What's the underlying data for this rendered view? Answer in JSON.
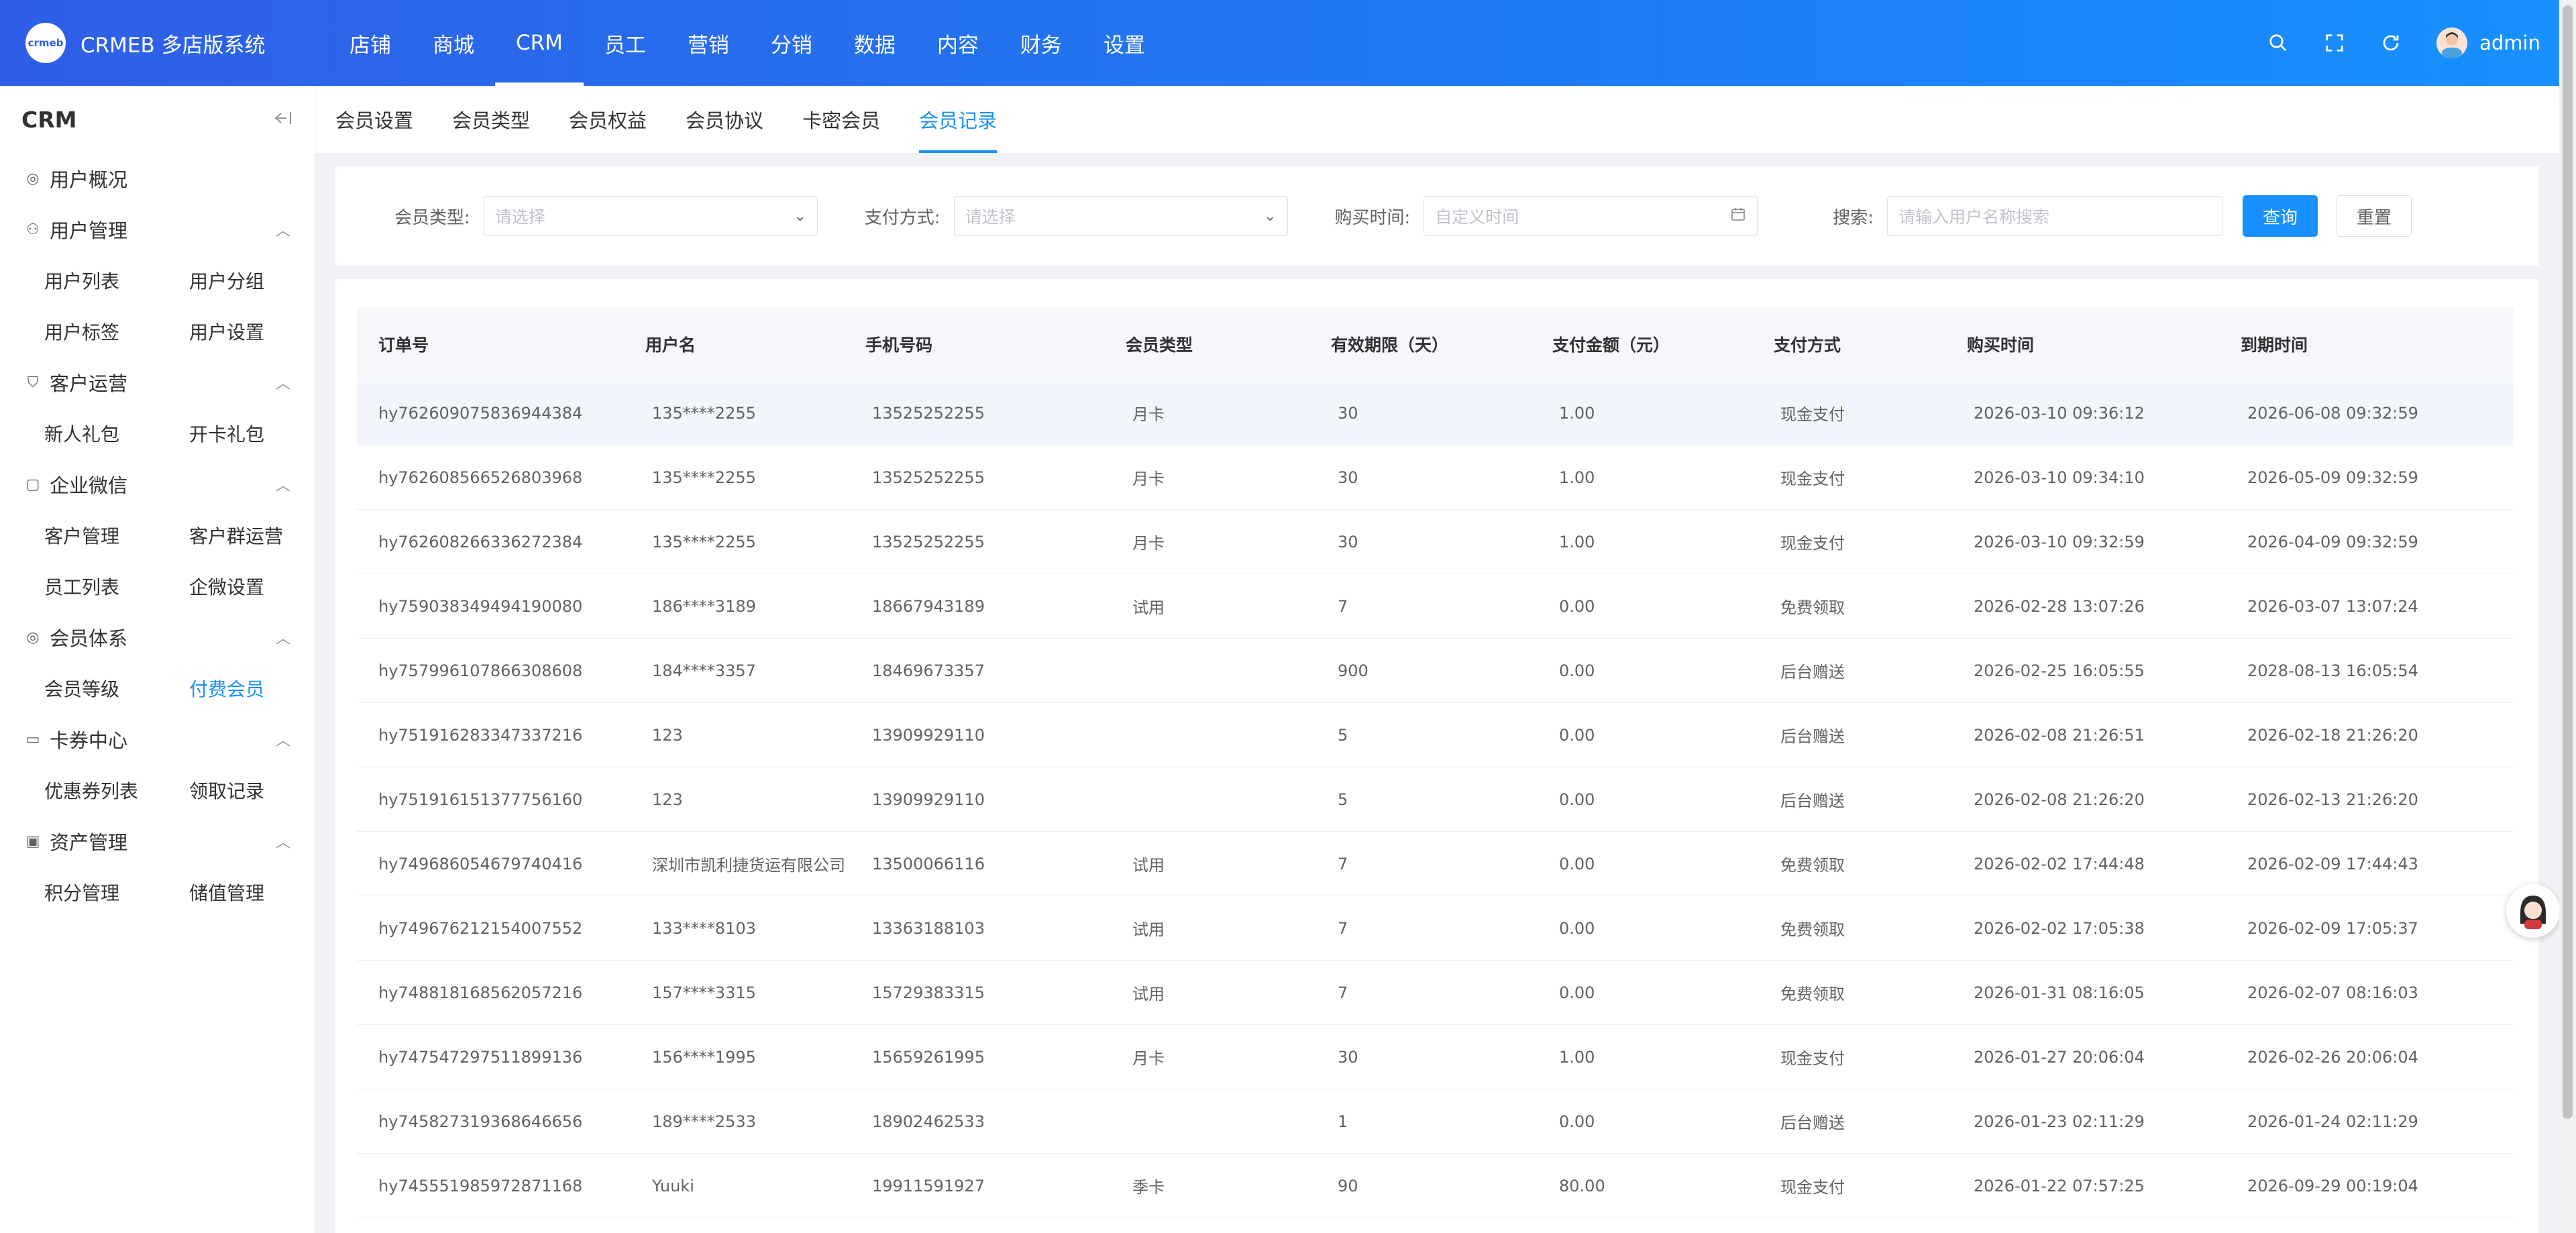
{
  "app": {
    "logo_text": "crmeb",
    "name": "CRMEB 多店版系统",
    "top_nav": [
      "店铺",
      "商城",
      "CRM",
      "员工",
      "营销",
      "分销",
      "数据",
      "内容",
      "财务",
      "设置"
    ],
    "top_nav_active": "CRM",
    "user_name": "admin",
    "accent_color": "#1890ff"
  },
  "sidebar": {
    "title": "CRM",
    "overview": "用户概况",
    "groups": [
      {
        "title": "用户管理",
        "icon": "user-icon",
        "items": [
          "用户列表",
          "用户分组",
          "用户标签",
          "用户设置"
        ]
      },
      {
        "title": "客户运营",
        "icon": "filter-icon",
        "items": [
          "新人礼包",
          "开卡礼包"
        ]
      },
      {
        "title": "企业微信",
        "icon": "chat-icon",
        "items": [
          "客户管理",
          "客户群运营",
          "员工列表",
          "企微设置"
        ]
      },
      {
        "title": "会员体系",
        "icon": "member-icon",
        "items": [
          "会员等级",
          "付费会员"
        ]
      },
      {
        "title": "卡券中心",
        "icon": "card-icon",
        "items": [
          "优惠券列表",
          "领取记录"
        ]
      },
      {
        "title": "资产管理",
        "icon": "wallet-icon",
        "items": [
          "积分管理",
          "储值管理"
        ]
      }
    ],
    "active_item": "付费会员"
  },
  "tabs": [
    "会员设置",
    "会员类型",
    "会员权益",
    "会员协议",
    "卡密会员",
    "会员记录"
  ],
  "active_tab": "会员记录",
  "filters": {
    "member_type_label": "会员类型:",
    "member_type_placeholder": "请选择",
    "pay_method_label": "支付方式:",
    "pay_method_placeholder": "请选择",
    "buy_time_label": "购买时间:",
    "buy_time_placeholder": "自定义时间",
    "search_label": "搜索:",
    "search_placeholder": "请输入用户名称搜索",
    "query_button": "查询",
    "reset_button": "重置"
  },
  "table": {
    "columns": [
      "订单号",
      "用户名",
      "手机号码",
      "会员类型",
      "有效期限（天）",
      "支付金额（元）",
      "支付方式",
      "购买时间",
      "到期时间"
    ],
    "rows": [
      [
        "hy762609075836944384",
        "135****2255",
        "13525252255",
        "月卡",
        "30",
        "1.00",
        "现金支付",
        "2026-03-10 09:36:12",
        "2026-06-08 09:32:59"
      ],
      [
        "hy762608566526803968",
        "135****2255",
        "13525252255",
        "月卡",
        "30",
        "1.00",
        "现金支付",
        "2026-03-10 09:34:10",
        "2026-05-09 09:32:59"
      ],
      [
        "hy762608266336272384",
        "135****2255",
        "13525252255",
        "月卡",
        "30",
        "1.00",
        "现金支付",
        "2026-03-10 09:32:59",
        "2026-04-09 09:32:59"
      ],
      [
        "hy759038349494190080",
        "186****3189",
        "18667943189",
        "试用",
        "7",
        "0.00",
        "免费领取",
        "2026-02-28 13:07:26",
        "2026-03-07 13:07:24"
      ],
      [
        "hy757996107866308608",
        "184****3357",
        "18469673357",
        "",
        "900",
        "0.00",
        "后台赠送",
        "2026-02-25 16:05:55",
        "2028-08-13 16:05:54"
      ],
      [
        "hy751916283347337216",
        "123",
        "13909929110",
        "",
        "5",
        "0.00",
        "后台赠送",
        "2026-02-08 21:26:51",
        "2026-02-18 21:26:20"
      ],
      [
        "hy751916151377756160",
        "123",
        "13909929110",
        "",
        "5",
        "0.00",
        "后台赠送",
        "2026-02-08 21:26:20",
        "2026-02-13 21:26:20"
      ],
      [
        "hy749686054679740416",
        "深圳市凯利捷货运有限公司",
        "13500066116",
        "试用",
        "7",
        "0.00",
        "免费领取",
        "2026-02-02 17:44:48",
        "2026-02-09 17:44:43"
      ],
      [
        "hy749676212154007552",
        "133****8103",
        "13363188103",
        "试用",
        "7",
        "0.00",
        "免费领取",
        "2026-02-02 17:05:38",
        "2026-02-09 17:05:37"
      ],
      [
        "hy748818168562057216",
        "157****3315",
        "15729383315",
        "试用",
        "7",
        "0.00",
        "免费领取",
        "2026-01-31 08:16:05",
        "2026-02-07 08:16:03"
      ],
      [
        "hy747547297511899136",
        "156****1995",
        "15659261995",
        "月卡",
        "30",
        "1.00",
        "现金支付",
        "2026-01-27 20:06:04",
        "2026-02-26 20:06:04"
      ],
      [
        "hy745827319368646656",
        "189****2533",
        "18902462533",
        "",
        "1",
        "0.00",
        "后台赠送",
        "2026-01-23 02:11:29",
        "2026-01-24 02:11:29"
      ],
      [
        "hy745551985972871168",
        "Yuuki",
        "19911591927",
        "季卡",
        "90",
        "80.00",
        "现金支付",
        "2026-01-22 07:57:25",
        "2026-09-29 00:19:04"
      ]
    ]
  }
}
